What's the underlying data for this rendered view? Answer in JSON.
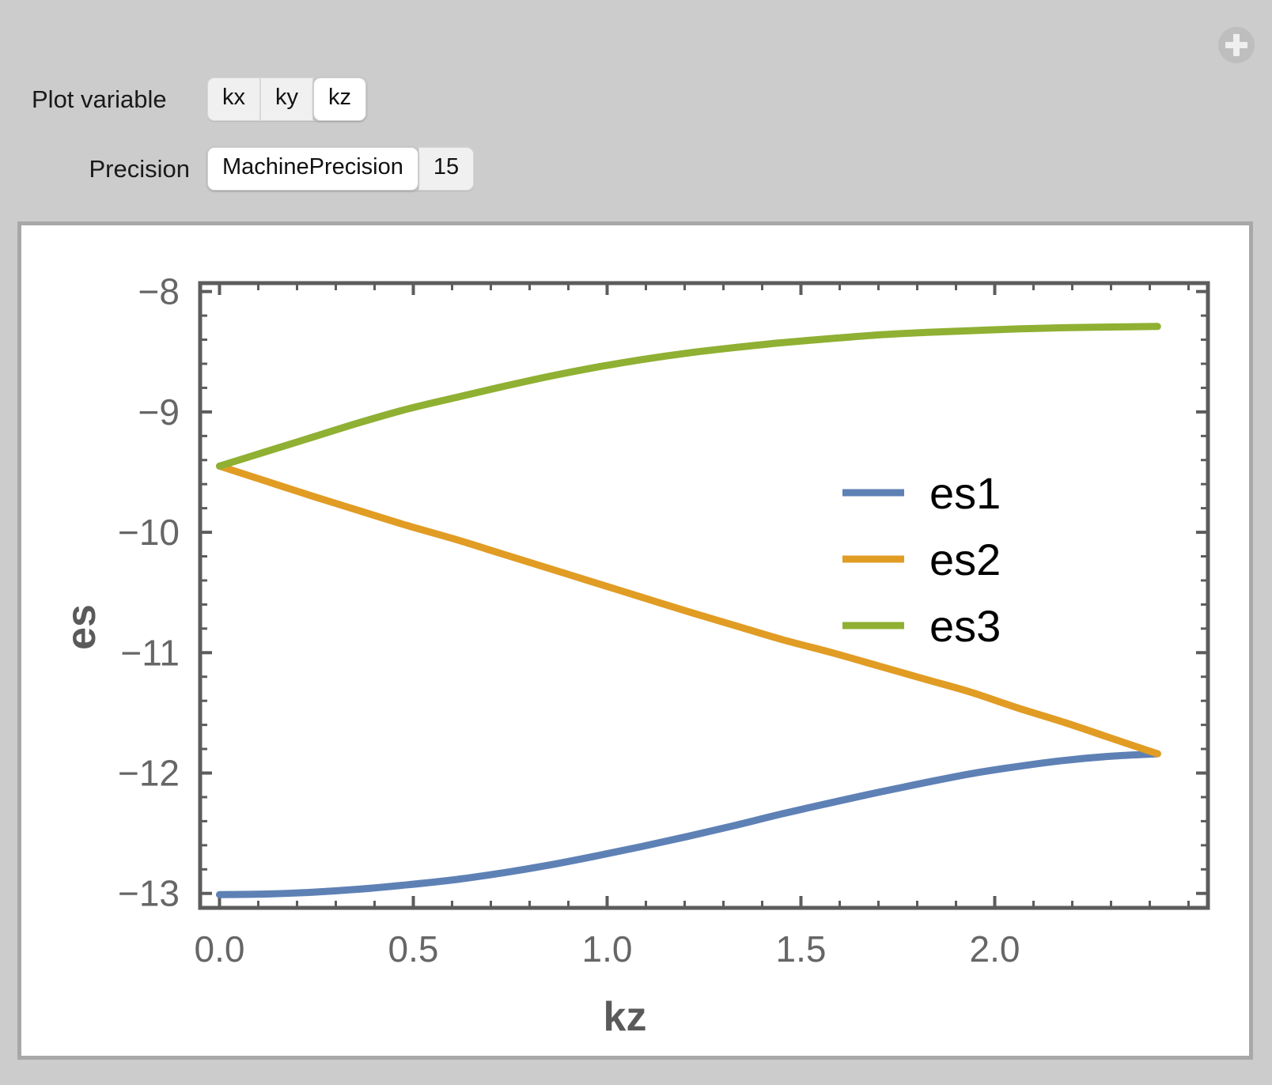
{
  "controls": {
    "plot_variable": {
      "label": "Plot variable",
      "options": [
        "kx",
        "ky",
        "kz"
      ],
      "selected": "kz"
    },
    "precision": {
      "label": "Precision",
      "options": [
        "MachinePrecision",
        "15"
      ],
      "selected": "MachinePrecision"
    },
    "add_control_icon": "plus-circle-icon"
  },
  "chart_data": {
    "type": "line",
    "title": "",
    "xlabel": "kz",
    "ylabel": "es",
    "xlim": [
      -0.05,
      2.55
    ],
    "ylim": [
      -13.12,
      -7.93
    ],
    "xticks": [
      0.0,
      0.5,
      1.0,
      1.5,
      2.0
    ],
    "xticklabels": [
      "0.0",
      "0.5",
      "1.0",
      "1.5",
      "2.0"
    ],
    "yticks": [
      -8,
      -9,
      -10,
      -11,
      -12,
      -13
    ],
    "yticklabels": [
      "-8",
      "-9",
      "-10",
      "-11",
      "-12",
      "-13"
    ],
    "x_minor_step": 0.1,
    "y_minor_step": 0.2,
    "grid": false,
    "frame": true,
    "legend_position": "center-right",
    "colors": {
      "es1": "#5e81b5",
      "es2": "#e19c24",
      "es3": "#8fb032",
      "frame": "#5c5c5c",
      "tick_label": "#666666",
      "axis_label": "#5a5a5a"
    },
    "x": [
      0.0,
      0.12,
      0.24,
      0.36,
      0.48,
      0.61,
      0.73,
      0.85,
      0.97,
      1.09,
      1.21,
      1.33,
      1.45,
      1.58,
      1.7,
      1.82,
      1.94,
      2.06,
      2.18,
      2.3,
      2.42
    ],
    "series": [
      {
        "name": "es1",
        "color": "#5e81b5",
        "values": [
          -13.01,
          -13.005,
          -12.99,
          -12.965,
          -12.93,
          -12.885,
          -12.83,
          -12.765,
          -12.69,
          -12.61,
          -12.525,
          -12.435,
          -12.34,
          -12.245,
          -12.16,
          -12.08,
          -12.005,
          -11.945,
          -11.895,
          -11.86,
          -11.84
        ]
      },
      {
        "name": "es2",
        "color": "#e19c24",
        "values": [
          -9.45,
          -9.575,
          -9.7,
          -9.82,
          -9.94,
          -10.06,
          -10.18,
          -10.3,
          -10.42,
          -10.54,
          -10.66,
          -10.775,
          -10.89,
          -11.0,
          -11.11,
          -11.22,
          -11.33,
          -11.46,
          -11.58,
          -11.71,
          -11.84
        ]
      },
      {
        "name": "es3",
        "color": "#8fb032",
        "values": [
          -9.45,
          -9.33,
          -9.21,
          -9.09,
          -8.98,
          -8.88,
          -8.79,
          -8.705,
          -8.63,
          -8.565,
          -8.51,
          -8.465,
          -8.425,
          -8.39,
          -8.36,
          -8.34,
          -8.325,
          -8.31,
          -8.3,
          -8.295,
          -8.29
        ]
      }
    ],
    "legend": [
      {
        "label": "es1",
        "color": "#5e81b5"
      },
      {
        "label": "es2",
        "color": "#e19c24"
      },
      {
        "label": "es3",
        "color": "#8fb032"
      }
    ]
  }
}
